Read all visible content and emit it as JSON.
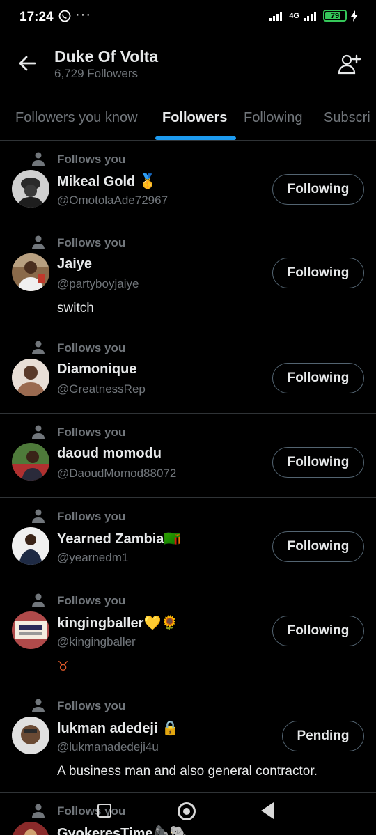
{
  "status": {
    "time": "17:24",
    "network": "4G",
    "battery": "79",
    "battery_level": 0.79
  },
  "header": {
    "title": "Duke Of Volta",
    "subtitle": "6,729 Followers"
  },
  "tabs": [
    {
      "label": "Followers you know"
    },
    {
      "label": "Followers"
    },
    {
      "label": "Following"
    },
    {
      "label": "Subscri"
    }
  ],
  "follows_label": "Follows you",
  "users": [
    {
      "name": "Mikeal Gold 🥇",
      "handle": "@OmotolaAde72967",
      "bio": "",
      "button": "Following",
      "avatar_color": "#c9c9c9"
    },
    {
      "name": "Jaiye",
      "handle": "@partyboyjaiye",
      "bio": "switch",
      "button": "Following",
      "avatar_color": "#c98a5a"
    },
    {
      "name": "Diamonique",
      "handle": "@GreatnessRep",
      "bio": "",
      "button": "Following",
      "avatar_color": "#b28770"
    },
    {
      "name": "daoud momodu",
      "handle": "@DaoudMomod88072",
      "bio": "",
      "button": "Following",
      "avatar_color": "#5d7f4a"
    },
    {
      "name": "Yearned Zambia🇿🇲",
      "handle": "@yearnedm1",
      "bio": "",
      "button": "Following",
      "avatar_color": "#e8e8e8"
    },
    {
      "name": "kingingballer💛🌻",
      "handle": "@kingingballer",
      "bio": "♉",
      "button": "Following",
      "avatar_color": "#c85a5a"
    },
    {
      "name": "lukman adedeji 🔒",
      "handle": "@lukmanadedeji4u",
      "bio": "A business man and also general contractor.",
      "button": "Pending",
      "avatar_color": "#d8d8d8"
    },
    {
      "name": "GyokeresTime🦍🐘",
      "handle": "",
      "bio": "",
      "button": "",
      "avatar_color": "#8a2a2a"
    }
  ]
}
